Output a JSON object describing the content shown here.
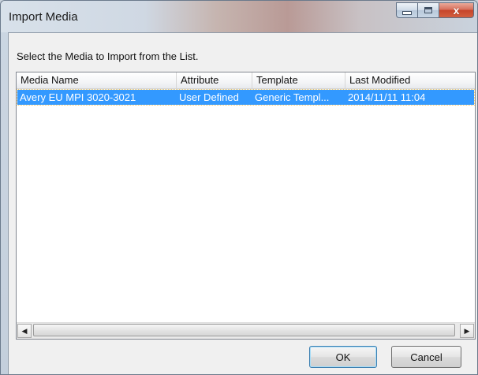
{
  "window": {
    "title": "Import Media",
    "minimize_label": "",
    "maximize_label": "",
    "close_label": "x"
  },
  "instruction": "Select the Media to Import from the List.",
  "list": {
    "columns": [
      "Media Name",
      "Attribute",
      "Template",
      "Last Modified"
    ],
    "rows": [
      {
        "media_name": "Avery EU MPI 3020-3021",
        "attribute": "User Defined",
        "template": "Generic Templ...",
        "last_modified": "2014/11/11 11:04",
        "selected": true
      }
    ]
  },
  "scrollbar": {
    "left_arrow": "◀",
    "right_arrow": "▶"
  },
  "buttons": {
    "ok_label": "OK",
    "cancel_label": "Cancel"
  },
  "colors": {
    "selection": "#3399ff",
    "close_button": "#c6452b"
  }
}
